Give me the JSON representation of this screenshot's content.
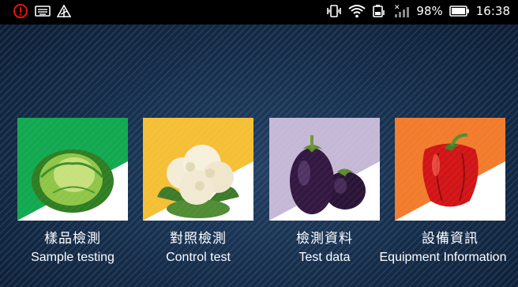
{
  "status_bar": {
    "time": "16:38",
    "battery_percent": "98%",
    "left_icons": [
      "alert-circle-icon",
      "keyboard-icon",
      "cell-no-signal-icon"
    ],
    "right_icons": [
      "vibrate-icon",
      "wifi-icon",
      "battery-saver-icon",
      "signal-off-icon",
      "battery-icon"
    ]
  },
  "menu": {
    "items": [
      {
        "zh": "樣品檢測",
        "en": "Sample testing",
        "image": "cabbage",
        "accent": "#12a84f"
      },
      {
        "zh": "對照檢測",
        "en": "Control test",
        "image": "cauliflower",
        "accent": "#f5bf35"
      },
      {
        "zh": "檢測資料",
        "en": "Test data",
        "image": "eggplant",
        "accent": "#c5b8d6"
      },
      {
        "zh": "設備資訊",
        "en": "Equipment Information",
        "image": "red-pepper",
        "accent": "#f27b2c"
      }
    ]
  }
}
